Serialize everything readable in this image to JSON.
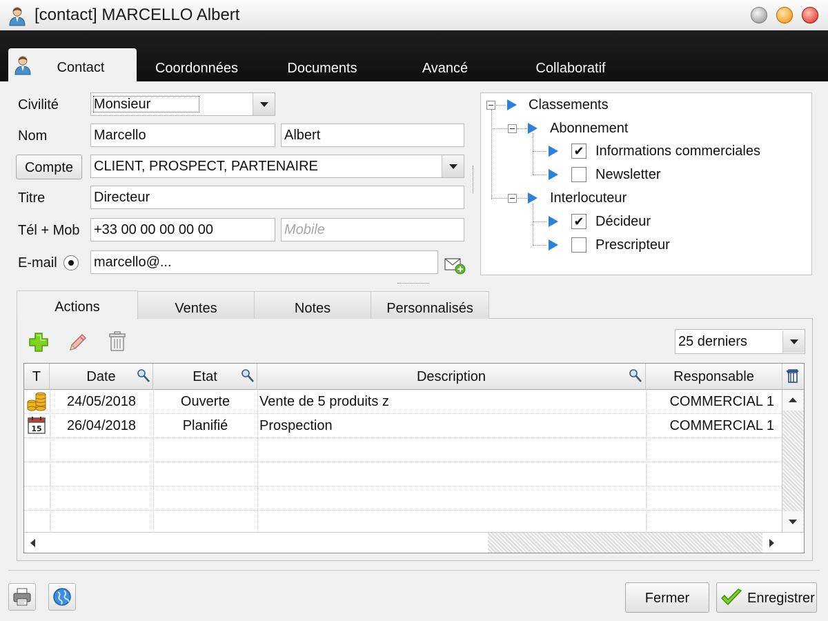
{
  "window": {
    "title": "[contact] MARCELLO Albert"
  },
  "main_tabs": [
    {
      "label": "Contact",
      "active": true
    },
    {
      "label": "Coordonnées"
    },
    {
      "label": "Documents"
    },
    {
      "label": "Avancé"
    },
    {
      "label": "Collaboratif"
    }
  ],
  "form": {
    "civilite": {
      "label": "Civilité",
      "value": "Monsieur"
    },
    "nom": {
      "label": "Nom",
      "last": "Marcello",
      "first": "Albert"
    },
    "compte": {
      "button": "Compte",
      "value": "CLIENT, PROSPECT, PARTENAIRE"
    },
    "titre": {
      "label": "Titre",
      "value": "Directeur"
    },
    "tel": {
      "label": "Tél + Mob",
      "value": "+33 00 00 00 00 00",
      "mobile_placeholder": "Mobile"
    },
    "email": {
      "label": "E-mail",
      "value": "marcello@..."
    }
  },
  "tree": {
    "root": "Classements",
    "groups": [
      {
        "label": "Abonnement",
        "items": [
          {
            "label": "Informations commerciales",
            "checked": true
          },
          {
            "label": "Newsletter",
            "checked": false
          }
        ]
      },
      {
        "label": "Interlocuteur",
        "items": [
          {
            "label": "Décideur",
            "checked": true
          },
          {
            "label": "Prescripteur",
            "checked": false
          }
        ]
      }
    ],
    "check_mark": "✔"
  },
  "sub_tabs": [
    {
      "label": "Actions",
      "active": true
    },
    {
      "label": "Ventes"
    },
    {
      "label": "Notes"
    },
    {
      "label": "Personnalisés"
    }
  ],
  "actions": {
    "filter": "25 derniers",
    "columns": [
      "T",
      "Date",
      "Etat",
      "Description",
      "Responsable"
    ],
    "rows": [
      {
        "type_icon": "coins-icon",
        "date": "24/05/2018",
        "etat": "Ouverte",
        "description": "Vente de 5 produits z",
        "responsable": "COMMERCIAL 1"
      },
      {
        "type_icon": "calendar-icon",
        "date": "26/04/2018",
        "etat": "Planifié",
        "description": "Prospection",
        "responsable": "COMMERCIAL 1"
      }
    ],
    "calendar_day": "15"
  },
  "footer": {
    "close": "Fermer",
    "save": "Enregistrer"
  },
  "colors": {
    "accent_blue": "#2b7fe0",
    "tabbar_bg": "#111111",
    "add_green": "#6cc51b"
  }
}
